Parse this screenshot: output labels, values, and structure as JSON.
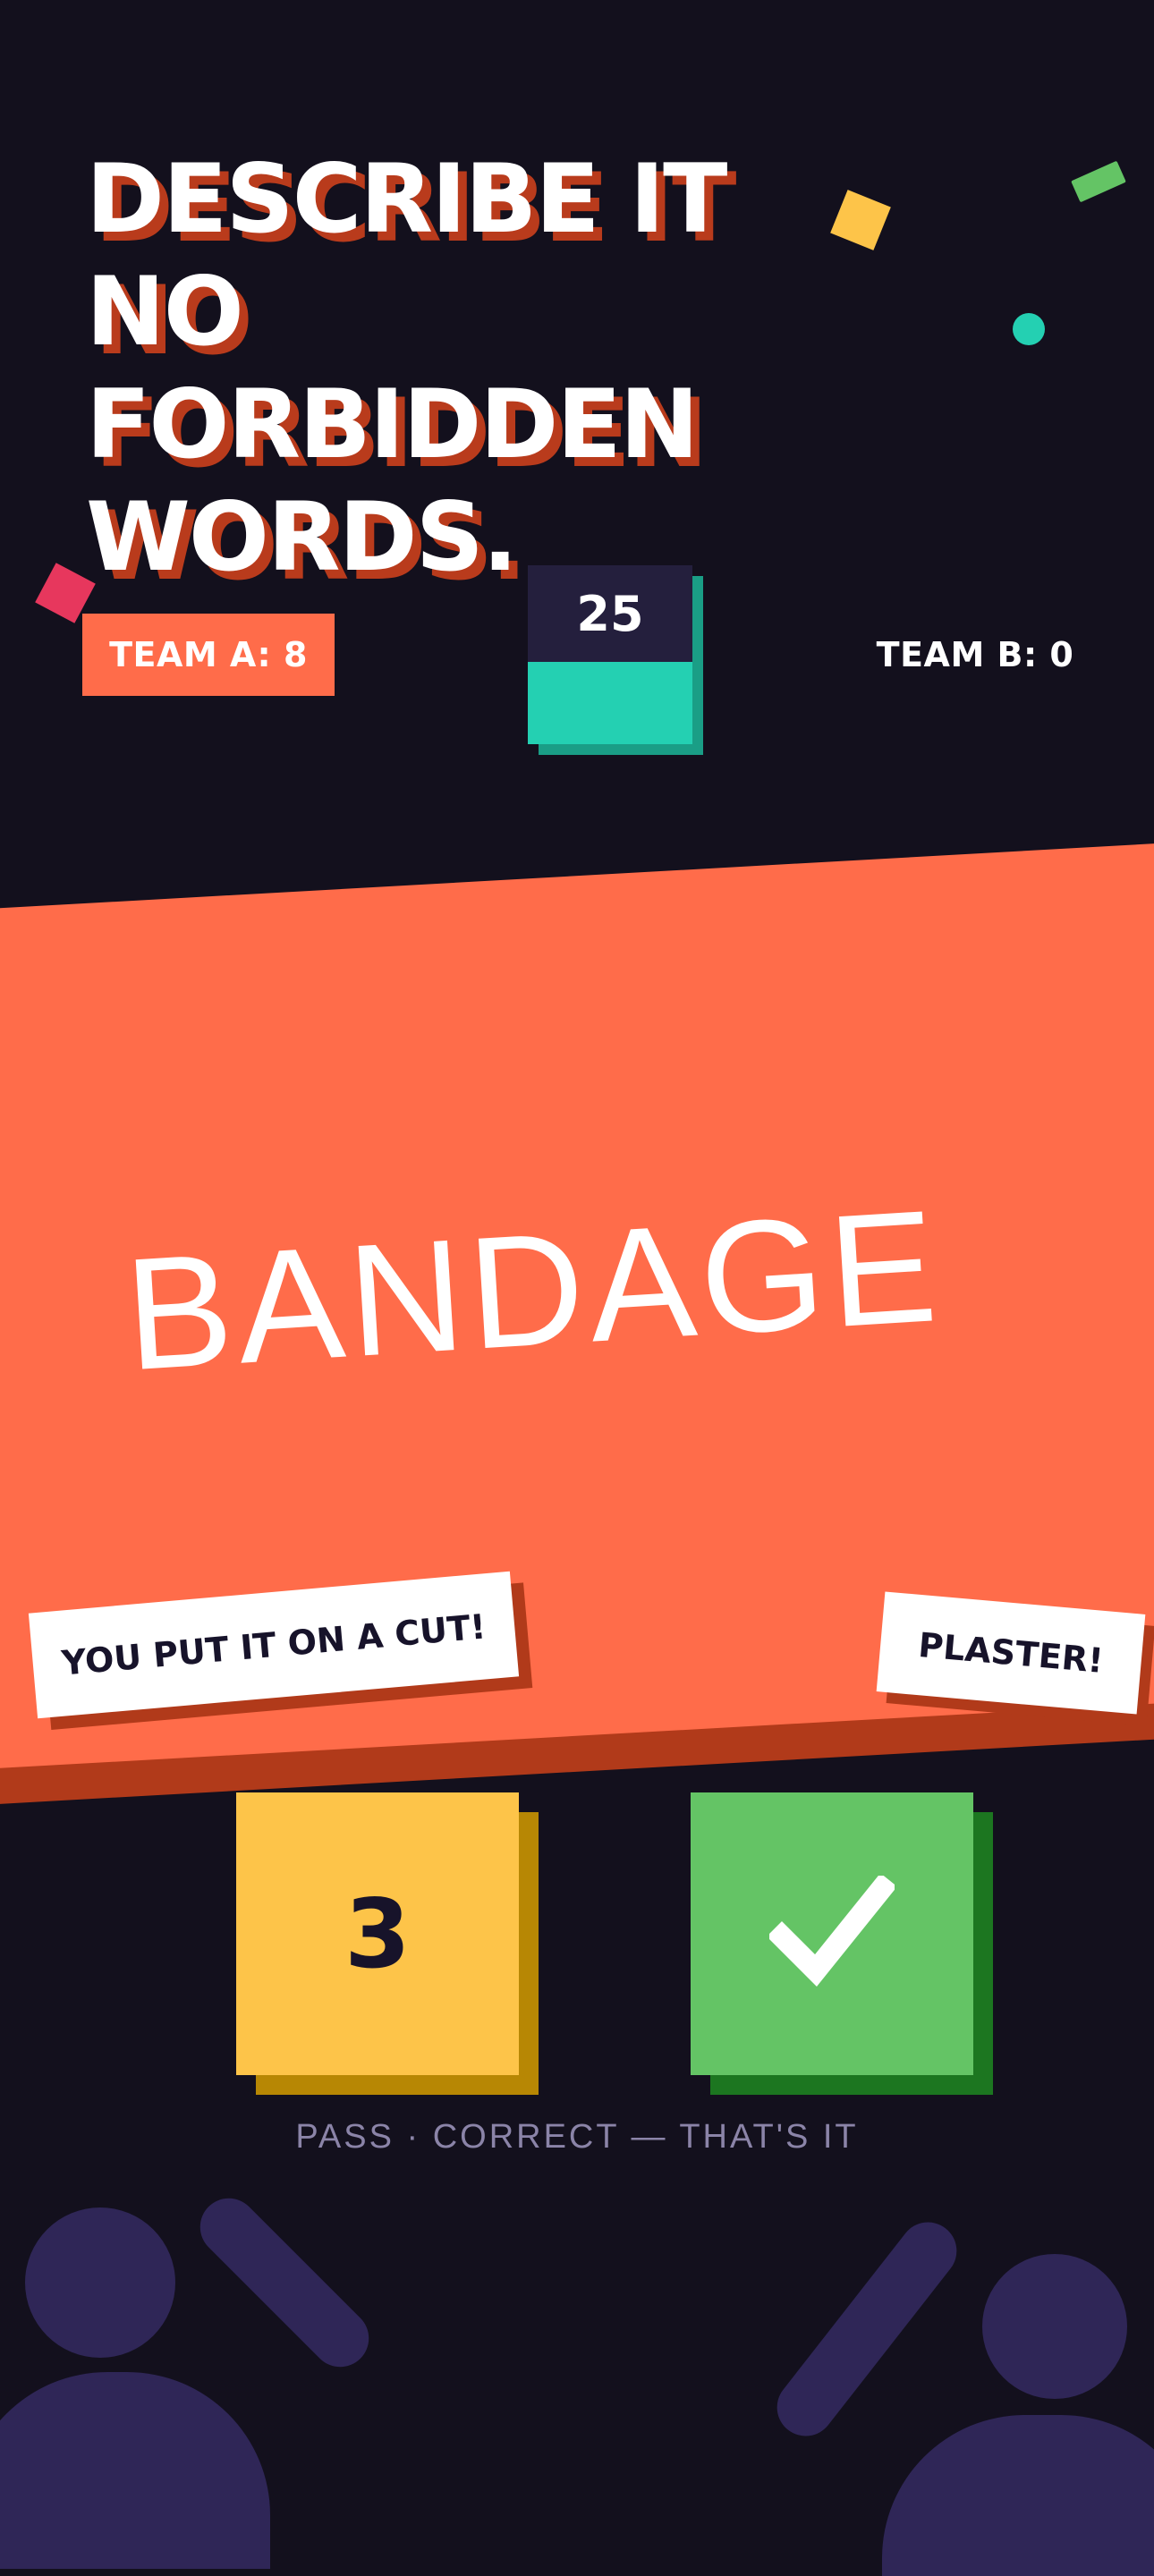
{
  "headline": {
    "lines": [
      "DESCRIBE IT",
      "NO",
      "FORBIDDEN",
      "WORDS."
    ]
  },
  "scoreboard": {
    "team_a": "TEAM A: 8",
    "team_b": "TEAM B: 0",
    "timer_value": "25"
  },
  "card": {
    "word": "BANDAGE",
    "clue_tag": "YOU PUT IT ON A CUT!",
    "answer_tag": "PLASTER!"
  },
  "controls": {
    "pass_count": "3",
    "correct_icon": "check-icon",
    "hint": "PASS · CORRECT — THAT'S IT"
  },
  "colors": {
    "background": "#13101d",
    "accent_orange": "#ff6c4a",
    "accent_teal": "#24d0b2",
    "accent_yellow": "#fdc449",
    "accent_green": "#64c465",
    "deco_purple": "#2f2657"
  }
}
